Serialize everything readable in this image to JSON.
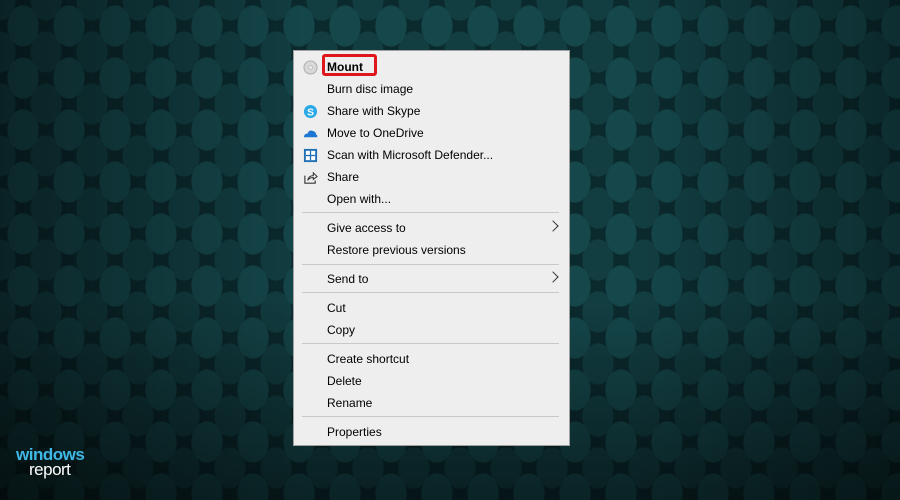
{
  "menu": {
    "items": [
      {
        "label": "Mount",
        "icon": "disc-icon"
      },
      {
        "label": "Burn disc image"
      },
      {
        "label": "Share with Skype",
        "icon": "skype-icon"
      },
      {
        "label": "Move to OneDrive",
        "icon": "onedrive-icon"
      },
      {
        "label": "Scan with Microsoft Defender...",
        "icon": "defender-icon"
      },
      {
        "label": "Share",
        "icon": "share-icon"
      },
      {
        "label": "Open with..."
      },
      {
        "label": "Give access to"
      },
      {
        "label": "Restore previous versions"
      },
      {
        "label": "Send to"
      },
      {
        "label": "Cut"
      },
      {
        "label": "Copy"
      },
      {
        "label": "Create shortcut"
      },
      {
        "label": "Delete"
      },
      {
        "label": "Rename"
      },
      {
        "label": "Properties"
      }
    ]
  },
  "watermark": {
    "line1": "windows",
    "line2": "report"
  },
  "colors": {
    "highlight": "#e0161d",
    "skype": "#2aa9e6",
    "onedrive": "#1c76d2",
    "defender": "#1f6fb5"
  }
}
